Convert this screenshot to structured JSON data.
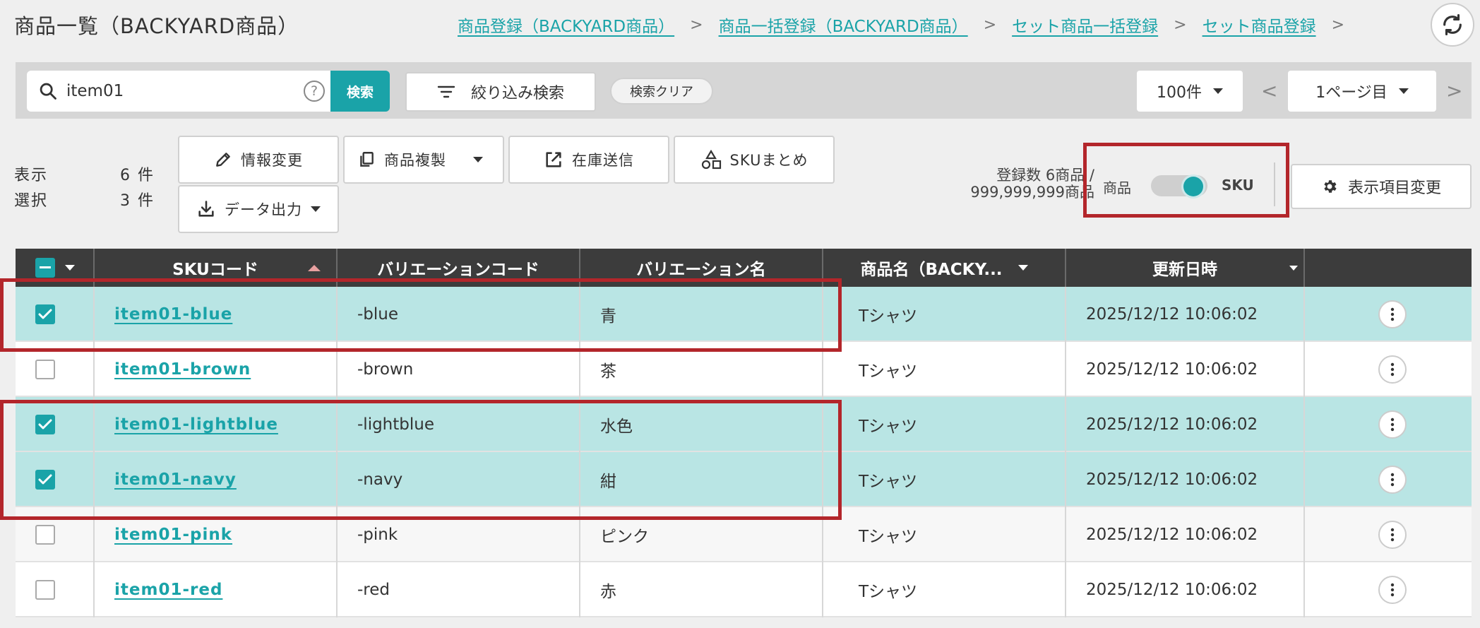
{
  "header": {
    "title": "商品一覧（BACKYARD商品）",
    "breadcrumbs": [
      "商品登録（BACKYARD商品）",
      "商品一括登録（BACKYARD商品）",
      "セット商品一括登録",
      "セット商品登録"
    ],
    "crumb_sep": ">"
  },
  "search": {
    "value": "item01",
    "help_label": "?",
    "search_button": "検索",
    "filter_button": "絞り込み検索",
    "clear_button": "検索クリア",
    "per_page": "100件",
    "page": "1ページ目",
    "prev": "<",
    "next": ">"
  },
  "counts": {
    "display_label": "表示",
    "display_value": "6 件",
    "selected_label": "選択",
    "selected_value": "3 件"
  },
  "actions": {
    "edit_info": "情報変更",
    "duplicate": "商品複製",
    "send_stock": "在庫送信",
    "sku_merge": "SKUまとめ",
    "export": "データ出力"
  },
  "registered": {
    "line1": "登録数 6商品 /",
    "line2": "999,999,999商品"
  },
  "view_toggle": {
    "left_label": "商品",
    "right_label": "SKU",
    "active": "SKU"
  },
  "display_settings_button": "表示項目変更",
  "table": {
    "headers": [
      "SKUコード",
      "バリエーションコード",
      "バリエーション名",
      "商品名（BACKY...",
      "更新日時"
    ],
    "rows": [
      {
        "sku": "item01-blue",
        "var_code": "-blue",
        "var_name": "青",
        "product": "Tシャツ",
        "updated": "2025/12/12 10:06:02",
        "checked": true
      },
      {
        "sku": "item01-brown",
        "var_code": "-brown",
        "var_name": "茶",
        "product": "Tシャツ",
        "updated": "2025/12/12 10:06:02",
        "checked": false
      },
      {
        "sku": "item01-lightblue",
        "var_code": "-lightblue",
        "var_name": "水色",
        "product": "Tシャツ",
        "updated": "2025/12/12 10:06:02",
        "checked": true
      },
      {
        "sku": "item01-navy",
        "var_code": "-navy",
        "var_name": "紺",
        "product": "Tシャツ",
        "updated": "2025/12/12 10:06:02",
        "checked": true
      },
      {
        "sku": "item01-pink",
        "var_code": "-pink",
        "var_name": "ピンク",
        "product": "Tシャツ",
        "updated": "2025/12/12 10:06:02",
        "checked": false
      },
      {
        "sku": "item01-red",
        "var_code": "-red",
        "var_name": "赤",
        "product": "Tシャツ",
        "updated": "2025/12/12 10:06:02",
        "checked": false
      }
    ]
  },
  "colors": {
    "accent": "#1aa3a8",
    "selected_row": "#b9e5e4",
    "header_bg": "#3c3c3c",
    "highlight": "#b3262b"
  }
}
